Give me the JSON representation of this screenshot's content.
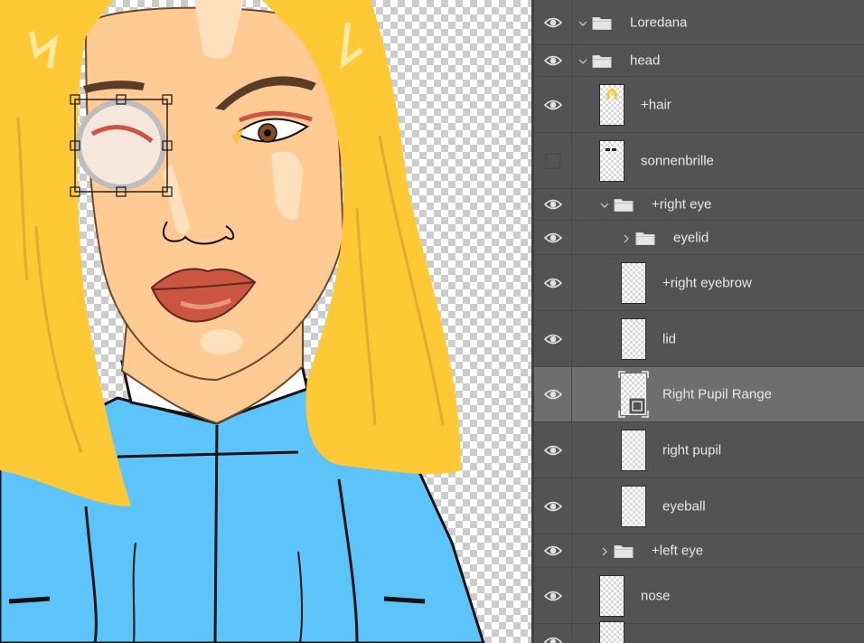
{
  "layers_panel": {
    "layers": [
      {
        "name": "Loredana",
        "kind": "group",
        "expanded": true,
        "visible": true
      },
      {
        "name": "head",
        "kind": "group",
        "expanded": true,
        "visible": true
      },
      {
        "name": "+hair",
        "kind": "layer",
        "visible": true
      },
      {
        "name": "sonnenbrille",
        "kind": "layer",
        "visible": false
      },
      {
        "name": "+right eye",
        "kind": "group",
        "expanded": true,
        "visible": true
      },
      {
        "name": "eyelid",
        "kind": "group",
        "expanded": false,
        "visible": true
      },
      {
        "name": "+right eyebrow",
        "kind": "layer",
        "visible": true
      },
      {
        "name": "lid",
        "kind": "layer",
        "visible": true
      },
      {
        "name": "Right Pupil Range",
        "kind": "smart-object",
        "visible": true,
        "selected": true
      },
      {
        "name": "right pupil",
        "kind": "layer",
        "visible": true
      },
      {
        "name": "eyeball",
        "kind": "layer",
        "visible": true
      },
      {
        "name": "+left eye",
        "kind": "group",
        "expanded": false,
        "visible": true
      },
      {
        "name": "nose",
        "kind": "layer",
        "visible": true
      },
      {
        "name": "",
        "kind": "layer",
        "visible": true
      }
    ]
  },
  "icons": {
    "visibility": "eye-icon",
    "group": "folder-icon",
    "expanded": "chevron-down-icon",
    "collapsed": "chevron-right-icon",
    "smart_object": "smart-object-badge-icon"
  },
  "colors": {
    "panel_bg": "#535353",
    "selected_row": "#6e6e6e",
    "hair": "#ffc935",
    "skin": "#ffca94",
    "hoodie": "#5dc4fa",
    "lips": "#cc5542"
  }
}
